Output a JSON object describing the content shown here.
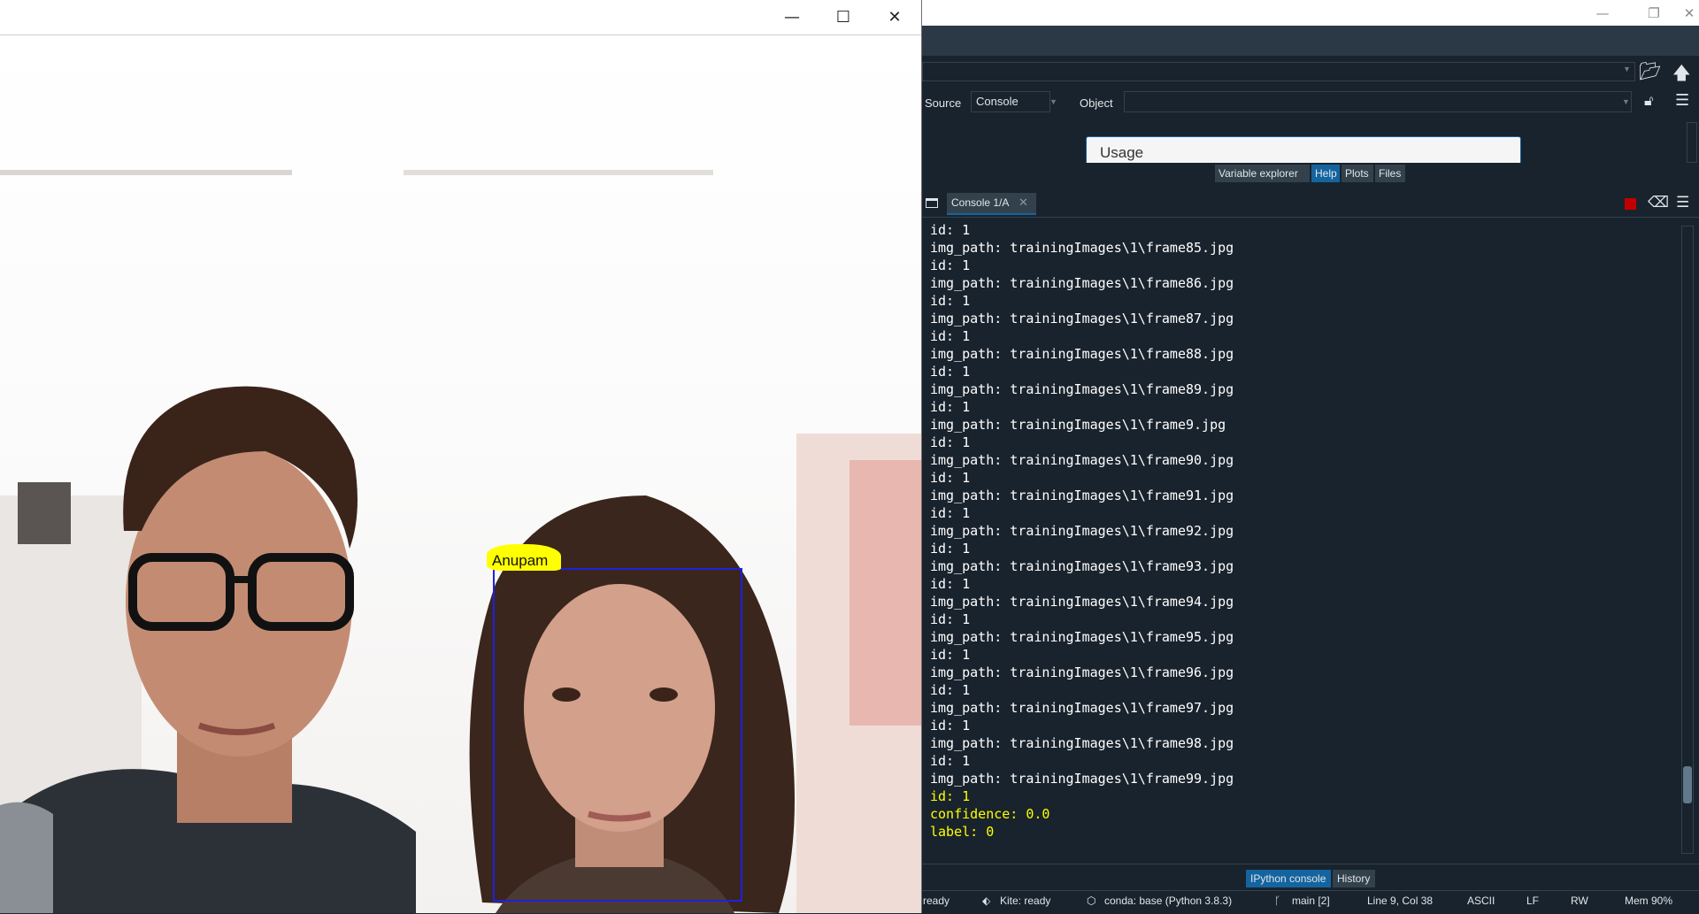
{
  "camera_window": {
    "minimize_glyph": "—",
    "maximize_glyph": "☐",
    "close_glyph": "✕",
    "detected_name": "Anupam"
  },
  "spyder": {
    "help_pane": {
      "source_label": "Source",
      "source_value": "Console",
      "object_label": "Object",
      "object_value": "",
      "usage_title": "Usage"
    },
    "pane_tabs": [
      "Variable explorer",
      "Help",
      "Plots",
      "Files"
    ],
    "active_pane_tab": "Help",
    "console_tab_label": "Console 1/A",
    "console_lines": [
      "id: 1",
      "img_path: trainingImages\\1\\frame85.jpg",
      "id: 1",
      "img_path: trainingImages\\1\\frame86.jpg",
      "id: 1",
      "img_path: trainingImages\\1\\frame87.jpg",
      "id: 1",
      "img_path: trainingImages\\1\\frame88.jpg",
      "id: 1",
      "img_path: trainingImages\\1\\frame89.jpg",
      "id: 1",
      "img_path: trainingImages\\1\\frame9.jpg",
      "id: 1",
      "img_path: trainingImages\\1\\frame90.jpg",
      "id: 1",
      "img_path: trainingImages\\1\\frame91.jpg",
      "id: 1",
      "img_path: trainingImages\\1\\frame92.jpg",
      "id: 1",
      "img_path: trainingImages\\1\\frame93.jpg",
      "id: 1",
      "img_path: trainingImages\\1\\frame94.jpg",
      "id: 1",
      "img_path: trainingImages\\1\\frame95.jpg",
      "id: 1",
      "img_path: trainingImages\\1\\frame96.jpg",
      "id: 1",
      "img_path: trainingImages\\1\\frame97.jpg",
      "id: 1",
      "img_path: trainingImages\\1\\frame98.jpg",
      "id: 1",
      "img_path: trainingImages\\1\\frame99.jpg"
    ],
    "highlighted_lines": [
      "id: 1",
      "confidence: 0.0",
      "label: 0"
    ],
    "bottom_tabs": [
      "IPython console",
      "History"
    ],
    "active_bottom_tab": "IPython console",
    "status": {
      "ready": "ready",
      "kite": "Kite: ready",
      "conda": "conda: base (Python 3.8.3)",
      "git": "main [2]",
      "position": "Line 9, Col 38",
      "encoding": "ASCII",
      "eol": "LF",
      "permissions": "RW",
      "memory": "Mem 90%"
    }
  },
  "colors": {
    "console_bg": "#19232d",
    "highlight_text": "#ffff00",
    "accent": "#1464a0",
    "face_box": "#2020e0"
  }
}
